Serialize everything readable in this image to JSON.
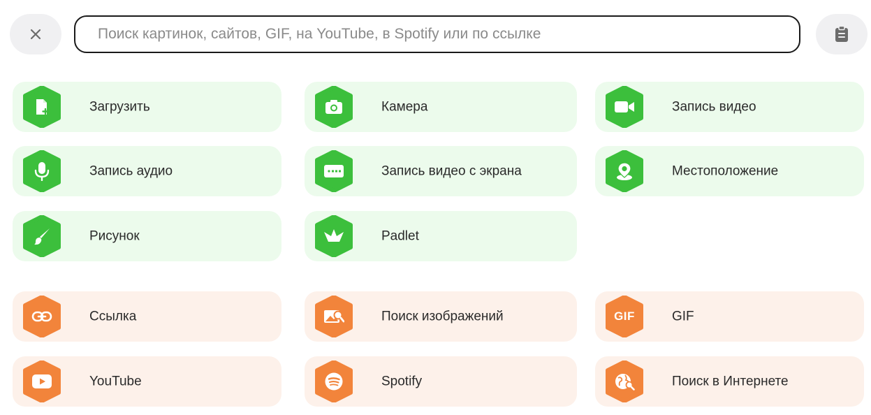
{
  "search": {
    "placeholder": "Поиск картинок, сайтов, GIF, на YouTube, в Spotify или по ссылке",
    "value": ""
  },
  "icons": {
    "close": "close-icon",
    "clipboard": "clipboard-icon"
  },
  "colors": {
    "green_icon": "#3cbf3c",
    "green_tile": "#ecfbec",
    "orange_icon": "#f2843b",
    "orange_tile": "#fdf1ea",
    "button_bg": "#f0f0f2"
  },
  "tiles": {
    "upload": {
      "label": "Загрузить",
      "icon": "upload-file-icon"
    },
    "camera": {
      "label": "Камера",
      "icon": "camera-icon"
    },
    "video": {
      "label": "Запись видео",
      "icon": "video-camera-icon"
    },
    "audio": {
      "label": "Запись аудио",
      "icon": "microphone-icon"
    },
    "screen": {
      "label": "Запись видео с экрана",
      "icon": "screen-record-icon"
    },
    "location": {
      "label": "Местоположение",
      "icon": "location-pin-icon"
    },
    "drawing": {
      "label": "Рисунок",
      "icon": "brush-icon"
    },
    "padlet": {
      "label": "Padlet",
      "icon": "padlet-icon"
    },
    "link": {
      "label": "Ссылка",
      "icon": "link-icon"
    },
    "image_search": {
      "label": "Поиск изображений",
      "icon": "image-search-icon"
    },
    "gif": {
      "label": "GIF",
      "icon": "gif-icon",
      "badge_text": "GIF"
    },
    "youtube": {
      "label": "YouTube",
      "icon": "youtube-icon"
    },
    "spotify": {
      "label": "Spotify",
      "icon": "spotify-icon"
    },
    "web_search": {
      "label": "Поиск в Интернете",
      "icon": "globe-icon"
    }
  }
}
